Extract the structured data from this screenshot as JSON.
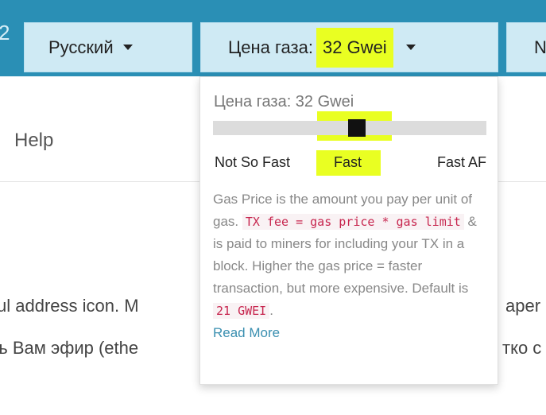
{
  "topbar": {
    "edge_char": "2",
    "language_label": "Русский",
    "gas_prefix": "Цена газа:",
    "gas_value": "32 Gwei",
    "next_label": "N"
  },
  "page": {
    "help": "Help",
    "line1_left": "ul address icon. M",
    "line1_right": "aper",
    "line2_left": "ъ Вам эфир (ethe",
    "line2_right": "тко с"
  },
  "gas_popover": {
    "title": "Цена газа: 32 Gwei",
    "slider_value_label": "Fast",
    "speeds": [
      "Not So Fast",
      "Fast",
      "Fast AF"
    ],
    "desc_1": "Gas Price is the amount you pay per unit of gas.",
    "code_1": "TX fee = gas price * gas limit",
    "desc_2": "& is paid to miners for including your TX in a block. Higher the gas price = faster transaction, but more expensive. Default is",
    "code_2": "21 GWEI",
    "desc_3": ".",
    "read_more": "Read More"
  },
  "colors": {
    "topbar": "#2a8fb5",
    "button_bg": "#cfeaf4",
    "highlight": "#e9ff22",
    "link": "#3a8fb0",
    "code": "#c7254e"
  }
}
